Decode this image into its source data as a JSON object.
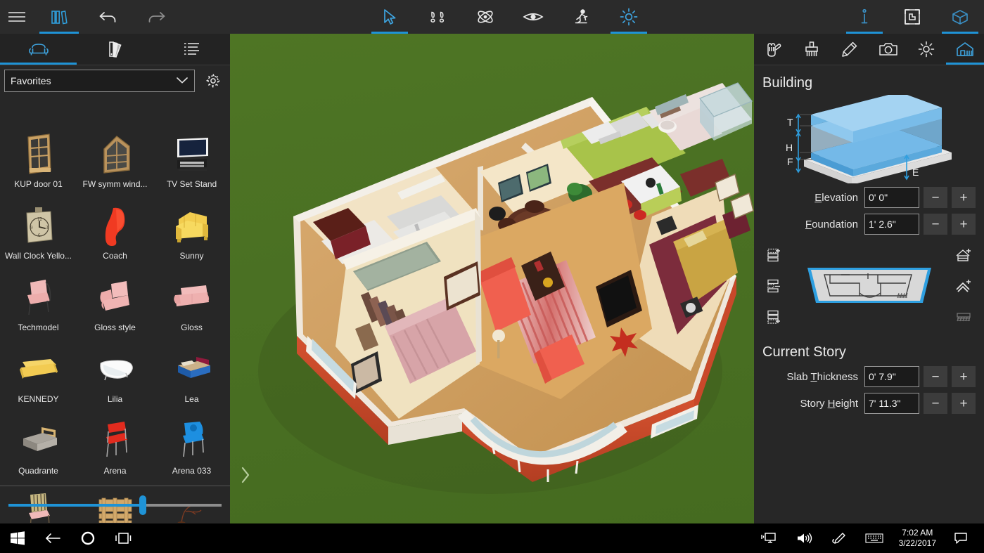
{
  "topbar": {
    "left": [
      {
        "name": "menu-icon",
        "label": "Menu",
        "active": false
      },
      {
        "name": "library-icon",
        "label": "Library",
        "active": true
      },
      {
        "name": "undo-icon",
        "label": "Undo",
        "active": false
      },
      {
        "name": "redo-icon",
        "label": "Redo",
        "active": false
      }
    ],
    "center": [
      {
        "name": "select-cursor-icon",
        "label": "Select",
        "active": true
      },
      {
        "name": "footprints-icon",
        "label": "Walk",
        "active": false
      },
      {
        "name": "orbit-icon",
        "label": "Orbit",
        "active": false
      },
      {
        "name": "eye-icon",
        "label": "View",
        "active": false
      },
      {
        "name": "person-walk-icon",
        "label": "Person",
        "active": false
      },
      {
        "name": "sun-icon",
        "label": "Sun",
        "active": true
      }
    ],
    "right": [
      {
        "name": "info-icon",
        "label": "Info",
        "active": true
      },
      {
        "name": "floorplan-icon",
        "label": "Floor Plan",
        "active": false
      },
      {
        "name": "3d-view-icon",
        "label": "3D View",
        "active": true
      }
    ]
  },
  "left_panel": {
    "tabs": [
      {
        "name": "tab-furniture",
        "label": "Furniture",
        "active": true
      },
      {
        "name": "tab-materials",
        "label": "Materials",
        "active": false
      },
      {
        "name": "tab-list",
        "label": "List",
        "active": false
      }
    ],
    "filter": {
      "value": "Favorites",
      "placeholder": "Favorites",
      "gear_label": "Settings"
    },
    "catalog": [
      {
        "label": "KUP door 01",
        "thumb": "door"
      },
      {
        "label": "FW symm wind...",
        "thumb": "window"
      },
      {
        "label": "TV Set Stand",
        "thumb": "tv"
      },
      {
        "label": "Wall Clock Yello...",
        "thumb": "clock"
      },
      {
        "label": "Coach",
        "thumb": "redchair"
      },
      {
        "label": "Sunny",
        "thumb": "yellowarm"
      },
      {
        "label": "Techmodel",
        "thumb": "pinkchair"
      },
      {
        "label": "Gloss style",
        "thumb": "pinkarm"
      },
      {
        "label": "Gloss",
        "thumb": "pinksofa"
      },
      {
        "label": "KENNEDY",
        "thumb": "yellowsofa"
      },
      {
        "label": "Lilia",
        "thumb": "bathtub"
      },
      {
        "label": "Lea",
        "thumb": "bluebed"
      },
      {
        "label": "Quadrante",
        "thumb": "greybed"
      },
      {
        "label": "Arena",
        "thumb": "redchair2"
      },
      {
        "label": "Arena 033",
        "thumb": "bluechair"
      },
      {
        "label": "",
        "thumb": "woodchair"
      },
      {
        "label": "",
        "thumb": "pallet"
      },
      {
        "label": "",
        "thumb": "plant"
      }
    ],
    "slider": {
      "percent": 63,
      "name": "thumbnail-size-slider"
    }
  },
  "viewport": {
    "expand_label": "›",
    "background_color": "#4a7023"
  },
  "right_panel": {
    "tabs": [
      {
        "name": "tab-hand-tool",
        "label": "Hand",
        "active": false
      },
      {
        "name": "tab-paintbrush",
        "label": "Paint",
        "active": false
      },
      {
        "name": "tab-pencil",
        "label": "Draw",
        "active": false
      },
      {
        "name": "tab-camera",
        "label": "Camera",
        "active": false
      },
      {
        "name": "tab-lighting",
        "label": "Lighting",
        "active": false
      },
      {
        "name": "tab-building",
        "label": "Building",
        "active": true
      }
    ],
    "building": {
      "title": "Building",
      "diagram_labels": [
        "T",
        "H",
        "F",
        "E"
      ],
      "fields": [
        {
          "name": "elevation",
          "label_pre": "",
          "label_key": "E",
          "label_post": "levation",
          "value": "0' 0\"",
          "minus": "−",
          "plus": "+"
        },
        {
          "name": "foundation",
          "label_pre": "",
          "label_key": "F",
          "label_post": "oundation",
          "value": "1' 2.6\"",
          "minus": "−",
          "plus": "+"
        }
      ]
    },
    "story_nav": {
      "left_icons": [
        {
          "name": "add-story-above-icon",
          "label": "Add story above"
        },
        {
          "name": "story-properties-icon",
          "label": "Story properties"
        },
        {
          "name": "add-story-below-icon",
          "label": "Add story below"
        }
      ],
      "right_icons": [
        {
          "name": "add-attic-icon",
          "label": "Add attic"
        },
        {
          "name": "add-roof-icon",
          "label": "Add roof"
        },
        {
          "name": "terrace-icon",
          "label": "Terrace",
          "disabled": true
        }
      ],
      "preview_label": "Story floor plan preview"
    },
    "current_story": {
      "title": "Current Story",
      "fields": [
        {
          "name": "slab-thickness",
          "label_pre": "Slab ",
          "label_key": "T",
          "label_post": "hickness",
          "value": "0' 7.9\"",
          "minus": "−",
          "plus": "+"
        },
        {
          "name": "story-height",
          "label_pre": "Story ",
          "label_key": "H",
          "label_post": "eight",
          "value": "7' 11.3\"",
          "minus": "−",
          "plus": "+"
        }
      ]
    }
  },
  "taskbar": {
    "left": [
      {
        "name": "windows-start-icon",
        "label": "Start"
      },
      {
        "name": "back-arrow-icon",
        "label": "Back"
      },
      {
        "name": "cortana-circle-icon",
        "label": "Cortana"
      },
      {
        "name": "task-view-icon",
        "label": "Task View"
      }
    ],
    "right": [
      {
        "name": "remote-display-icon",
        "label": "Display"
      },
      {
        "name": "volume-icon",
        "label": "Volume"
      },
      {
        "name": "pen-icon",
        "label": "Pen"
      },
      {
        "name": "keyboard-icon",
        "label": "Touch Keyboard"
      }
    ],
    "clock": {
      "time": "7:02 AM",
      "date": "3/22/2017"
    },
    "action_center": {
      "name": "action-center-icon",
      "label": "Notifications"
    }
  },
  "colors": {
    "accent": "#1f93d6",
    "panel_bg": "#272727",
    "topbar_bg": "#2b2b2b",
    "grass": "#4a7023",
    "taskbar_bg": "#000000"
  }
}
